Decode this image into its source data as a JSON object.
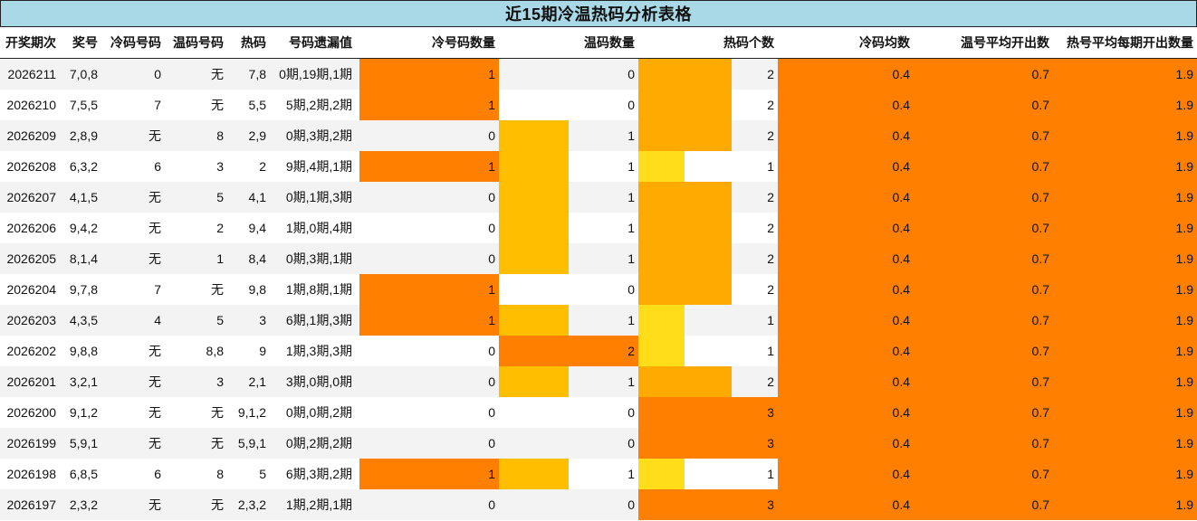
{
  "title": "近15期冷温热码分析表格",
  "colors": {
    "header_bg": "#a9d8e6",
    "cold_bar": "#ff8000",
    "warm_bar": "#ffbf00",
    "warm_bar_full": "#ff8000",
    "hot_bar_1": "#ffdd19",
    "hot_bar_2": "#ffaa00",
    "hot_bar_3": "#ff8000",
    "avg_fill": "#ff8000",
    "alt_row": "#f3f3f3"
  },
  "headers": [
    "开奖期次",
    "奖号",
    "冷码号码",
    "温码号码",
    "热码",
    "号码遗漏值",
    "冷号码数量",
    "温码数量",
    "热码个数",
    "冷码均数",
    "温号平均开出数",
    "热号平均每期开出数量"
  ],
  "rows": [
    {
      "period": "2026211",
      "number": "7,0,8",
      "cold": "0",
      "warm": "无",
      "hot": "7,8",
      "miss": "0期,19期,1期",
      "cold_count": 1,
      "warm_count": 0,
      "hot_count": 2,
      "cold_avg": "0.4",
      "warm_avg": "0.7",
      "hot_avg": "1.9"
    },
    {
      "period": "2026210",
      "number": "7,5,5",
      "cold": "7",
      "warm": "无",
      "hot": "5,5",
      "miss": "5期,2期,2期",
      "cold_count": 1,
      "warm_count": 0,
      "hot_count": 2,
      "cold_avg": "0.4",
      "warm_avg": "0.7",
      "hot_avg": "1.9"
    },
    {
      "period": "2026209",
      "number": "2,8,9",
      "cold": "无",
      "warm": "8",
      "hot": "2,9",
      "miss": "0期,3期,2期",
      "cold_count": 0,
      "warm_count": 1,
      "hot_count": 2,
      "cold_avg": "0.4",
      "warm_avg": "0.7",
      "hot_avg": "1.9"
    },
    {
      "period": "2026208",
      "number": "6,3,2",
      "cold": "6",
      "warm": "3",
      "hot": "2",
      "miss": "9期,4期,1期",
      "cold_count": 1,
      "warm_count": 1,
      "hot_count": 1,
      "cold_avg": "0.4",
      "warm_avg": "0.7",
      "hot_avg": "1.9"
    },
    {
      "period": "2026207",
      "number": "4,1,5",
      "cold": "无",
      "warm": "5",
      "hot": "4,1",
      "miss": "0期,1期,3期",
      "cold_count": 0,
      "warm_count": 1,
      "hot_count": 2,
      "cold_avg": "0.4",
      "warm_avg": "0.7",
      "hot_avg": "1.9"
    },
    {
      "period": "2026206",
      "number": "9,4,2",
      "cold": "无",
      "warm": "2",
      "hot": "9,4",
      "miss": "1期,0期,4期",
      "cold_count": 0,
      "warm_count": 1,
      "hot_count": 2,
      "cold_avg": "0.4",
      "warm_avg": "0.7",
      "hot_avg": "1.9"
    },
    {
      "period": "2026205",
      "number": "8,1,4",
      "cold": "无",
      "warm": "1",
      "hot": "8,4",
      "miss": "0期,3期,1期",
      "cold_count": 0,
      "warm_count": 1,
      "hot_count": 2,
      "cold_avg": "0.4",
      "warm_avg": "0.7",
      "hot_avg": "1.9"
    },
    {
      "period": "2026204",
      "number": "9,7,8",
      "cold": "7",
      "warm": "无",
      "hot": "9,8",
      "miss": "1期,8期,1期",
      "cold_count": 1,
      "warm_count": 0,
      "hot_count": 2,
      "cold_avg": "0.4",
      "warm_avg": "0.7",
      "hot_avg": "1.9"
    },
    {
      "period": "2026203",
      "number": "4,3,5",
      "cold": "4",
      "warm": "5",
      "hot": "3",
      "miss": "6期,1期,3期",
      "cold_count": 1,
      "warm_count": 1,
      "hot_count": 1,
      "cold_avg": "0.4",
      "warm_avg": "0.7",
      "hot_avg": "1.9"
    },
    {
      "period": "2026202",
      "number": "9,8,8",
      "cold": "无",
      "warm": "8,8",
      "hot": "9",
      "miss": "1期,3期,3期",
      "cold_count": 0,
      "warm_count": 2,
      "hot_count": 1,
      "cold_avg": "0.4",
      "warm_avg": "0.7",
      "hot_avg": "1.9"
    },
    {
      "period": "2026201",
      "number": "3,2,1",
      "cold": "无",
      "warm": "3",
      "hot": "2,1",
      "miss": "3期,0期,0期",
      "cold_count": 0,
      "warm_count": 1,
      "hot_count": 2,
      "cold_avg": "0.4",
      "warm_avg": "0.7",
      "hot_avg": "1.9"
    },
    {
      "period": "2026200",
      "number": "9,1,2",
      "cold": "无",
      "warm": "无",
      "hot": "9,1,2",
      "miss": "0期,0期,2期",
      "cold_count": 0,
      "warm_count": 0,
      "hot_count": 3,
      "cold_avg": "0.4",
      "warm_avg": "0.7",
      "hot_avg": "1.9"
    },
    {
      "period": "2026199",
      "number": "5,9,1",
      "cold": "无",
      "warm": "无",
      "hot": "5,9,1",
      "miss": "0期,2期,2期",
      "cold_count": 0,
      "warm_count": 0,
      "hot_count": 3,
      "cold_avg": "0.4",
      "warm_avg": "0.7",
      "hot_avg": "1.9"
    },
    {
      "period": "2026198",
      "number": "6,8,5",
      "cold": "6",
      "warm": "8",
      "hot": "5",
      "miss": "6期,3期,2期",
      "cold_count": 1,
      "warm_count": 1,
      "hot_count": 1,
      "cold_avg": "0.4",
      "warm_avg": "0.7",
      "hot_avg": "1.9"
    },
    {
      "period": "2026197",
      "number": "2,3,2",
      "cold": "无",
      "warm": "无",
      "hot": "2,3,2",
      "miss": "1期,2期,1期",
      "cold_count": 0,
      "warm_count": 0,
      "hot_count": 3,
      "cold_avg": "0.4",
      "warm_avg": "0.7",
      "hot_avg": "1.9"
    }
  ]
}
